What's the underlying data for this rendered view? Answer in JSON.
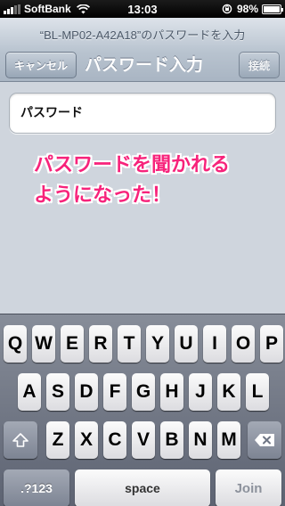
{
  "status_bar": {
    "carrier": "SoftBank",
    "time": "13:03",
    "battery_percent": "98%",
    "battery_level": 0.98,
    "icons": [
      "signal-icon",
      "wifi-icon",
      "lock-rotation-icon",
      "battery-icon"
    ]
  },
  "nav": {
    "prompt": "“BL-MP02-A42A18”のパスワードを入力",
    "title": "パスワード入力",
    "cancel_label": "キャンセル",
    "connect_label": "接続"
  },
  "password_field": {
    "placeholder": "パスワード",
    "value": ""
  },
  "annotation": {
    "line1": "パスワードを聞かれる",
    "line2": "ようになった！",
    "color": "#f7237b"
  },
  "keyboard": {
    "row1": [
      "Q",
      "W",
      "E",
      "R",
      "T",
      "Y",
      "U",
      "I",
      "O",
      "P"
    ],
    "row2": [
      "A",
      "S",
      "D",
      "F",
      "G",
      "H",
      "J",
      "K",
      "L"
    ],
    "row3": [
      "Z",
      "X",
      "C",
      "V",
      "B",
      "N",
      "M"
    ],
    "numbers_label": ".?123",
    "space_label": "space",
    "join_label": "Join",
    "shift_icon": "shift-icon",
    "delete_icon": "delete-icon"
  }
}
